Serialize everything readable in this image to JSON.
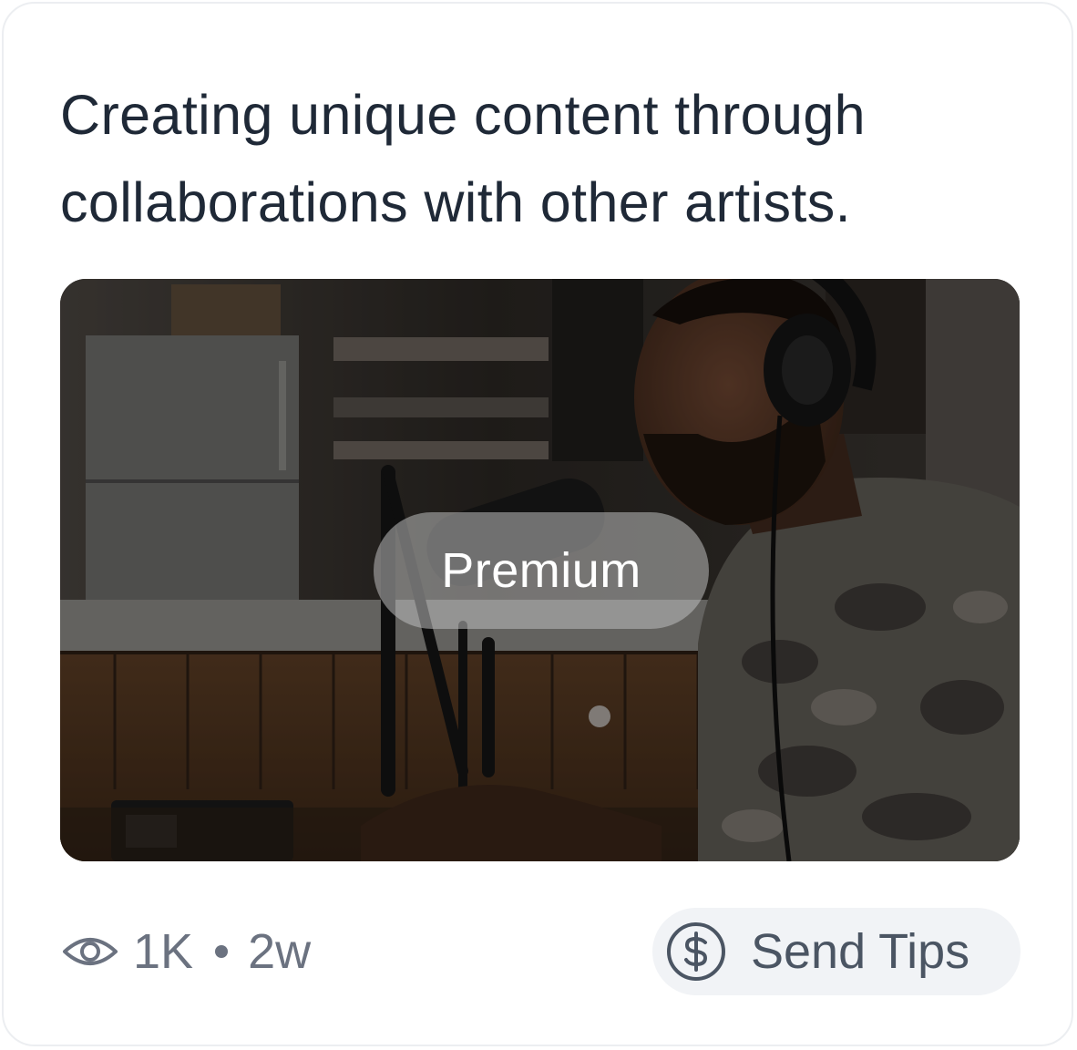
{
  "post": {
    "text": "Creating unique content through collaborations with other artists."
  },
  "media": {
    "badge_label": "Premium"
  },
  "stats": {
    "views": "1K",
    "age": "2w"
  },
  "actions": {
    "send_tips_label": "Send Tips"
  },
  "colors": {
    "text_primary": "#1f2937",
    "text_muted": "#6b7280",
    "button_bg": "#f1f3f6",
    "card_border": "#eceef1"
  },
  "icons": {
    "views": "eye-icon",
    "tips": "dollar-circle-icon"
  }
}
